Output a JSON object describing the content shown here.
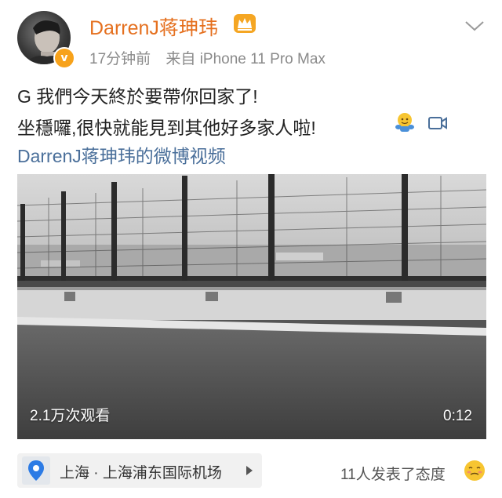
{
  "post": {
    "author": "DarrenJ蒋珅玮",
    "time": "17分钟前",
    "source": "来自 iPhone 11 Pro Max",
    "text_line1": "G 我們今天終於要帶你回家了!",
    "text_line2": "坐穩囉,很快就能見到其他好多家人啦!",
    "video_link": "DarrenJ蒋珅玮的微博视频"
  },
  "video": {
    "views": "2.1万次观看",
    "duration": "0:12"
  },
  "location": {
    "label": "上海 · 上海浦东国际机场"
  },
  "reactions": {
    "label": "11人发表了态度"
  },
  "icons": {
    "crown": "crown-icon",
    "chevron": "chevron-down-icon",
    "verified": "verified-badge-icon",
    "emoji": "hug-emoji-icon",
    "video": "video-camera-icon",
    "location": "location-pin-icon",
    "arrow": "play-arrow-icon",
    "reaction": "smirk-emoji-icon"
  },
  "colors": {
    "author": "#e5701f",
    "link": "#4a6f9a",
    "meta": "#8a8a8a",
    "verified": "#f7a21b"
  }
}
